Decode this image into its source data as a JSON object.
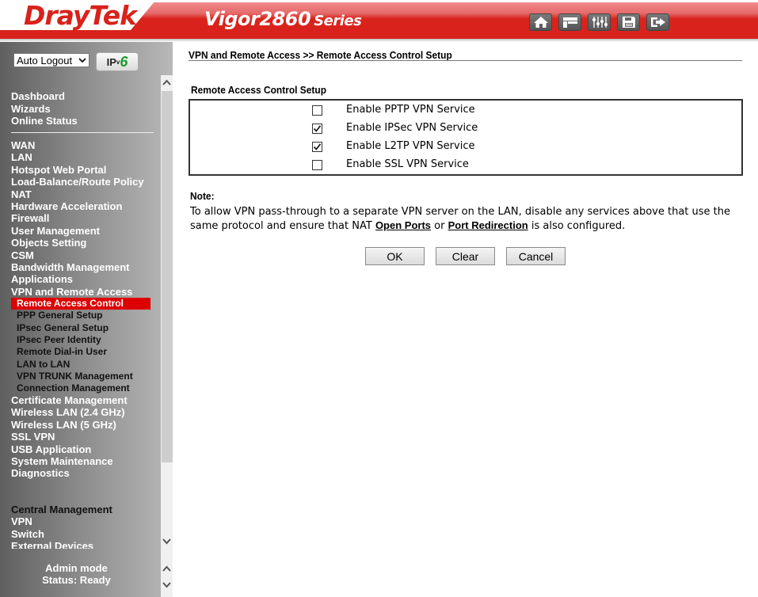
{
  "header": {
    "brand": "DrayTek",
    "model": "Vigor2860",
    "series": "Series",
    "toolbar": [
      {
        "icon": "home-icon",
        "label": "Home"
      },
      {
        "icon": "quick-start-icon",
        "label": "Quick Start"
      },
      {
        "icon": "settings-sliders-icon",
        "label": "Settings"
      },
      {
        "icon": "save-icon",
        "label": "Save"
      },
      {
        "icon": "logout-icon",
        "label": "Logout"
      }
    ]
  },
  "sidebar": {
    "auto_logout": "Auto Logout",
    "ipv6_label": "IP",
    "ipv6_v": "v",
    "ipv6_six": "6",
    "group1": [
      "Dashboard",
      "Wizards",
      "Online Status"
    ],
    "group2": [
      "WAN",
      "LAN",
      "Hotspot Web Portal",
      "Load-Balance/Route Policy",
      "NAT",
      "Hardware Acceleration",
      "Firewall",
      "User Management",
      "Objects Setting",
      "CSM",
      "Bandwidth Management",
      "Applications",
      "VPN and Remote Access"
    ],
    "vpn_sub": [
      "Remote Access Control",
      "PPP General Setup",
      "IPsec General Setup",
      "IPsec Peer Identity",
      "Remote Dial-in User",
      "LAN to LAN",
      "VPN TRUNK Management",
      "Connection Management"
    ],
    "active_sub": "Remote Access Control",
    "group3": [
      "Certificate Management",
      "Wireless LAN (2.4 GHz)",
      "Wireless LAN (5 GHz)",
      "SSL VPN",
      "USB Application",
      "System Maintenance",
      "Diagnostics"
    ],
    "central_title": "Central Management",
    "central": [
      "VPN",
      "Switch",
      "External Devices"
    ],
    "status_mode": "Admin mode",
    "status_text": "Status: Ready"
  },
  "content": {
    "breadcrumb": "VPN and Remote Access >> Remote Access Control Setup",
    "section_title": "Remote Access Control Setup",
    "options": [
      {
        "label": "Enable PPTP VPN Service",
        "checked": false
      },
      {
        "label": "Enable IPSec VPN Service",
        "checked": true
      },
      {
        "label": "Enable L2TP VPN Service",
        "checked": true
      },
      {
        "label": "Enable SSL VPN Service",
        "checked": false
      }
    ],
    "note_title": "Note:",
    "note_pre": "To allow VPN pass-through to a separate VPN server on the LAN, disable any services above that use the same protocol and ensure that NAT ",
    "note_link1": "Open Ports",
    "note_mid": " or ",
    "note_link2": "Port Redirection",
    "note_post": " is also configured.",
    "buttons": {
      "ok": "OK",
      "clear": "Clear",
      "cancel": "Cancel"
    }
  }
}
